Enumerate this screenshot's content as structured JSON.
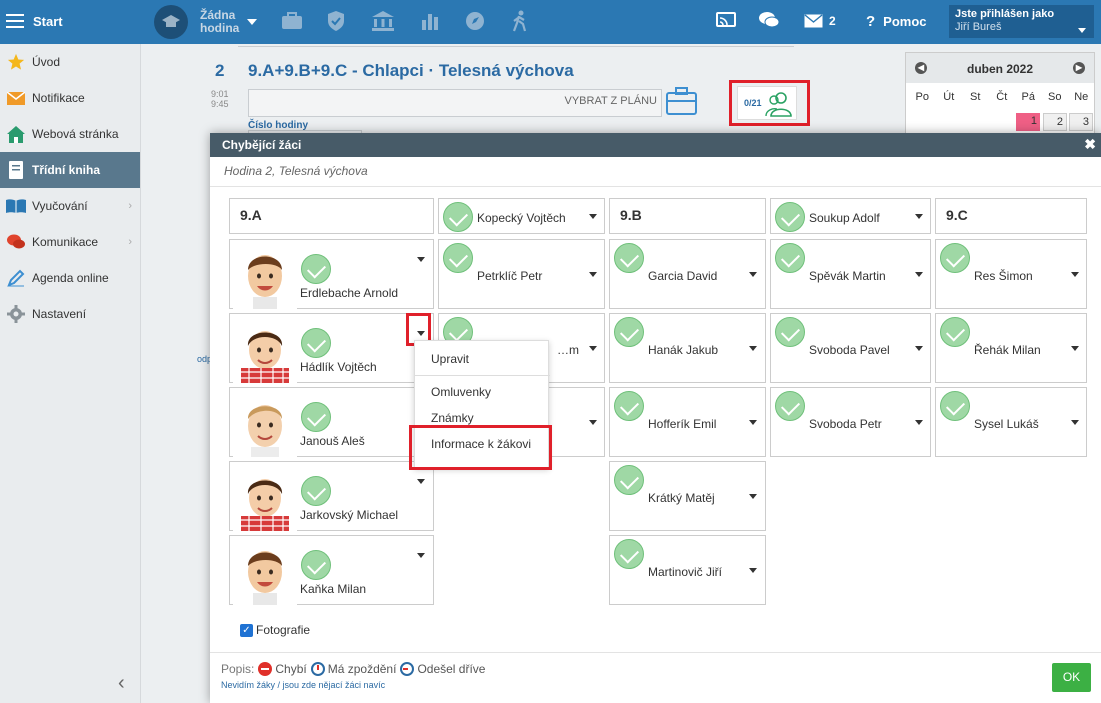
{
  "topbar": {
    "start_label": "Start",
    "hour_line1": "Žádna",
    "hour_line2": "hodina",
    "messages_count": "2",
    "help_label": "Pomoc",
    "logged_label": "Jste přihlášen jako",
    "user_name": "Jiří Bureš"
  },
  "sidebar": {
    "items": [
      {
        "label": "Úvod",
        "icon": "star-icon"
      },
      {
        "label": "Notifikace",
        "icon": "envelope-icon"
      },
      {
        "label": "Webová stránka",
        "icon": "home-icon"
      },
      {
        "label": "Třídní kniha",
        "icon": "book-icon"
      },
      {
        "label": "Vyučování",
        "icon": "open-book-icon"
      },
      {
        "label": "Komunikace",
        "icon": "chat-icon"
      },
      {
        "label": "Agenda online",
        "icon": "pen-icon"
      },
      {
        "label": "Nastavení",
        "icon": "gear-icon"
      }
    ]
  },
  "lesson": {
    "number": "2",
    "title": "9.A+9.B+9.C - Chlapci · Telesná výchova",
    "time_start": "9:01",
    "time_end": "9:45",
    "plan_placeholder": "VYBRAT Z PLÁNU",
    "lesson_number_label": "Číslo hodiny",
    "attendance": "0/21",
    "side_text": "odp"
  },
  "calendar": {
    "month": "duben 2022",
    "days": [
      "Po",
      "Út",
      "St",
      "Čt",
      "Pá",
      "So",
      "Ne"
    ],
    "dates": [
      "1",
      "2",
      "3"
    ]
  },
  "modal": {
    "title": "Chybějící žáci",
    "subtitle": "Hodina 2, Telesná výchova",
    "columns": [
      {
        "class_name": "9.A",
        "students": [
          "Erdlebache Arnold",
          "Hádlík Vojtěch",
          "Janouš Aleš",
          "Jarkovský Michael",
          "Kaňka Milan"
        ]
      },
      {
        "students": [
          "Kopecký Vojtěch",
          "Petrklíč Petr",
          "…m"
        ]
      },
      {
        "class_name": "9.B",
        "students": [
          "Garcia David",
          "Hanák Jakub",
          "Hofferík Emil",
          "Krátký Matěj",
          "Martinovič Jiří"
        ]
      },
      {
        "students": [
          "Soukup Adolf",
          "Spěvák Martin",
          "Svoboda Pavel",
          "Svoboda Petr"
        ]
      },
      {
        "class_name": "9.C",
        "students": [
          "Res Šimon",
          "Řehák Milan",
          "Sysel Lukáš"
        ]
      }
    ],
    "context_menu": [
      "Upravit",
      "Omluvenky",
      "Známky",
      "Informace k žákovi"
    ],
    "photos_label": "Fotografie",
    "legend_prefix": "Popis:",
    "legend_absent": "Chybí",
    "legend_late": "Má zpoždění",
    "legend_left": "Odešel dříve",
    "footer_link": "Nevidím žáky / jsou zde nějací žáci navíc",
    "ok_label": "OK"
  },
  "colors": {
    "topbar": "#2b78b3",
    "modal_header": "#475b68",
    "sidebar_active": "#59788d",
    "accent_red": "#e0202a",
    "ok_green": "#3cb044",
    "check_green": "#9fd8a5"
  }
}
